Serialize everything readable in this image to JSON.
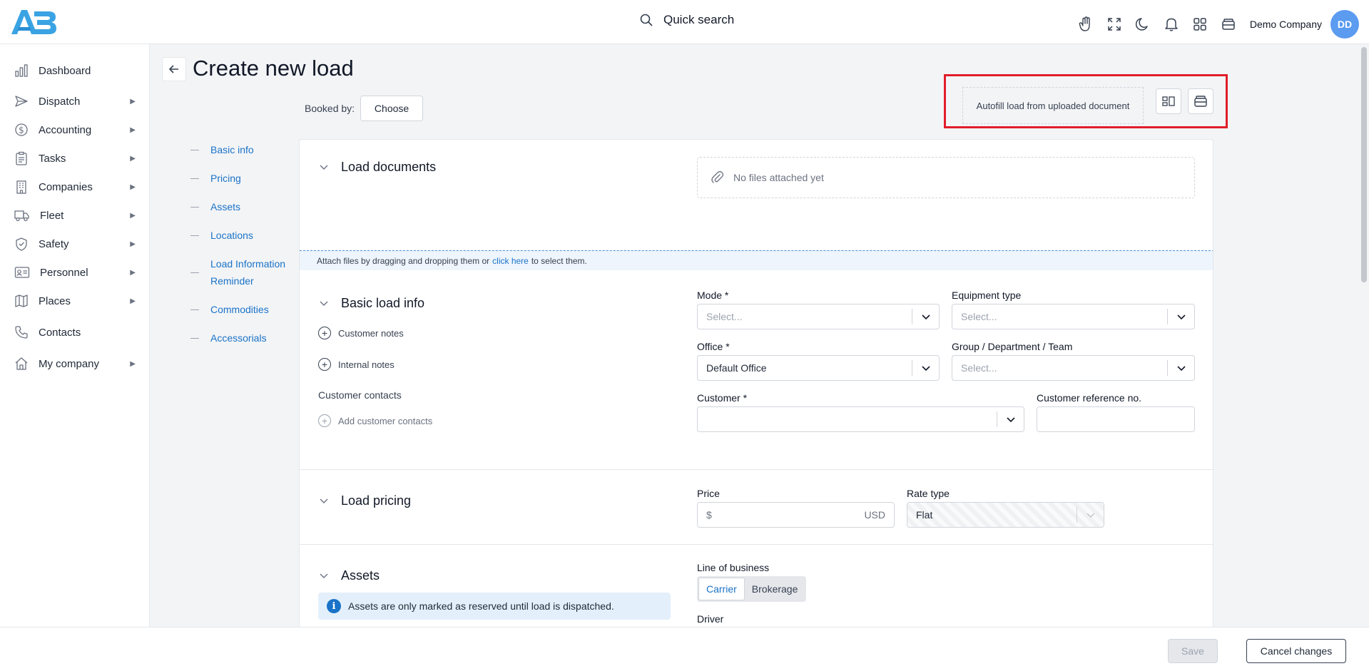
{
  "header": {
    "search_label": "Quick search",
    "company": "Demo Company",
    "avatar_initials": "DD"
  },
  "sidebar": {
    "items": [
      {
        "label": "Dashboard"
      },
      {
        "label": "Dispatch"
      },
      {
        "label": "Accounting"
      },
      {
        "label": "Tasks"
      },
      {
        "label": "Companies"
      },
      {
        "label": "Fleet"
      },
      {
        "label": "Safety"
      },
      {
        "label": "Personnel"
      },
      {
        "label": "Places"
      },
      {
        "label": "Contacts"
      },
      {
        "label": "My company"
      }
    ]
  },
  "page": {
    "title": "Create new load",
    "booked_by_label": "Booked by:",
    "choose_label": "Choose",
    "autofill_label": "Autofill load from uploaded document"
  },
  "section_nav": [
    "Basic info",
    "Pricing",
    "Assets",
    "Locations",
    "Load Information Reminder",
    "Commodities",
    "Accessorials"
  ],
  "documents": {
    "title": "Load documents",
    "empty": "No files attached yet",
    "attach_pre": "Attach files by dragging and dropping them or",
    "attach_link": "click here",
    "attach_post": "to select them."
  },
  "basic": {
    "title": "Basic load info",
    "customer_notes": "Customer notes",
    "internal_notes": "Internal notes",
    "customer_contacts": "Customer contacts",
    "add_contacts": "Add customer contacts",
    "mode_label": "Mode *",
    "mode_placeholder": "Select...",
    "equipment_label": "Equipment type",
    "equipment_placeholder": "Select...",
    "office_label": "Office *",
    "office_value": "Default Office",
    "group_label": "Group / Department / Team",
    "group_placeholder": "Select...",
    "customer_label": "Customer *",
    "customer_ref_label": "Customer reference no."
  },
  "pricing": {
    "title": "Load pricing",
    "price_label": "Price",
    "currency_symbol": "$",
    "currency": "USD",
    "rate_type_label": "Rate type",
    "rate_type_value": "Flat"
  },
  "assets": {
    "title": "Assets",
    "info": "Assets are only marked as reserved until load is dispatched.",
    "line_of_business_label": "Line of business",
    "carrier": "Carrier",
    "brokerage": "Brokerage",
    "driver_label": "Driver"
  },
  "footer": {
    "save": "Save",
    "cancel": "Cancel changes"
  },
  "colors": {
    "accent": "#1a73c8",
    "highlight_box": "#e11d2a",
    "avatar": "#5b9bf0"
  }
}
